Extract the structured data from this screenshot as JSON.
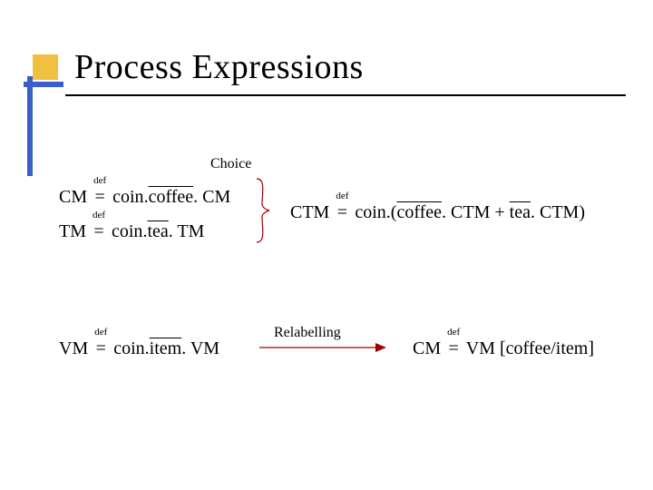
{
  "title": "Process Expressions",
  "sections": {
    "choice_label": "Choice",
    "relabel_label": "Relabelling"
  },
  "equations": {
    "cm_lhs": "CM",
    "cm_prefix": "coin",
    "cm_action": "coffee",
    "cm_rhs": "CM",
    "tm_lhs": "TM",
    "tm_prefix": "coin",
    "tm_action": "tea",
    "tm_rhs": "TM",
    "ctm_lhs": "CTM",
    "ctm_prefix": "coin",
    "ctm_opt1_action": "coffee",
    "ctm_opt1_rhs": "CTM",
    "ctm_opt2_action": "tea",
    "ctm_opt2_rhs": "CTM",
    "vm_lhs": "VM",
    "vm_prefix": "coin",
    "vm_action": "item",
    "vm_rhs": "VM",
    "cm2_lhs": "CM",
    "cm2_body": "VM [coffee/item]"
  }
}
